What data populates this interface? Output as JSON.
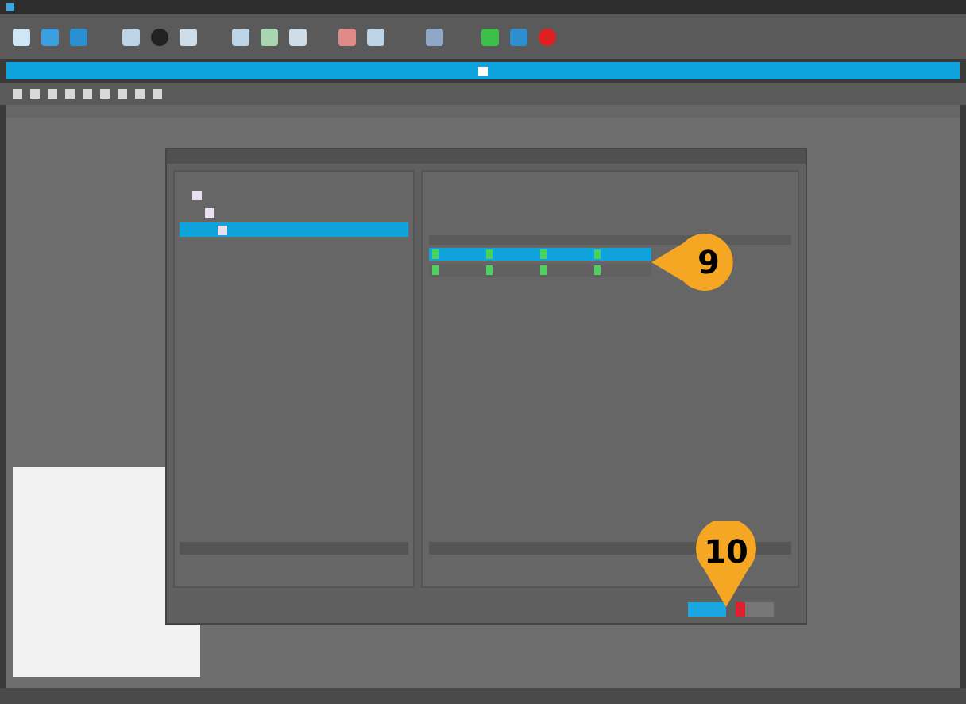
{
  "tree": {
    "items": [
      {
        "selected": false
      },
      {
        "selected": false
      },
      {
        "selected": true
      }
    ]
  },
  "table": {
    "rows": [
      {
        "selected": true
      },
      {
        "selected": false
      }
    ]
  },
  "callouts": [
    {
      "label": "9",
      "kind": "left"
    },
    {
      "label": "10",
      "kind": "down"
    }
  ]
}
